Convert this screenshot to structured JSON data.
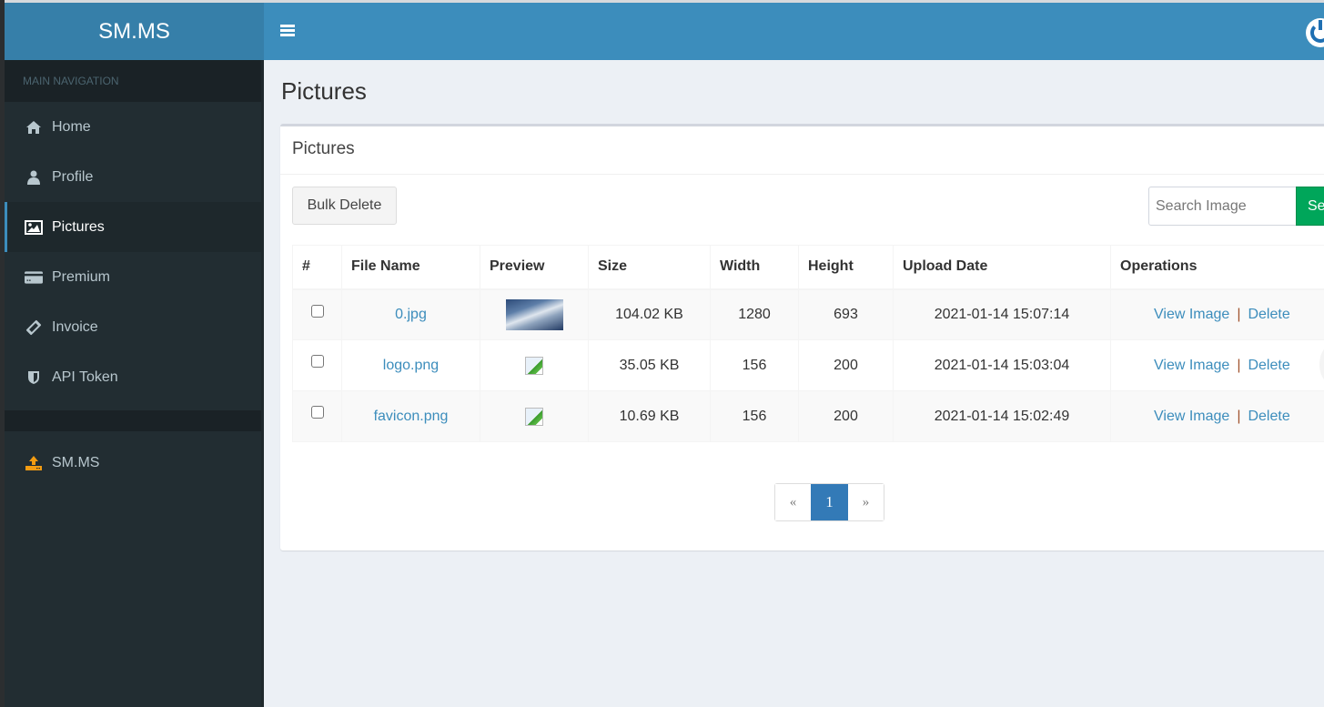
{
  "header": {
    "logo": "SM.MS",
    "menu_toggle_icon": "hamburger-icon",
    "power_icon": "power-icon"
  },
  "sidebar": {
    "section_header": "MAIN NAVIGATION",
    "items": [
      {
        "label": "Home",
        "icon": "home-icon",
        "active": false
      },
      {
        "label": "Profile",
        "icon": "user-icon",
        "active": false
      },
      {
        "label": "Pictures",
        "icon": "image-icon",
        "active": true
      },
      {
        "label": "Premium",
        "icon": "credit-card-icon",
        "active": false
      },
      {
        "label": "Invoice",
        "icon": "ticket-icon",
        "active": false
      },
      {
        "label": "API Token",
        "icon": "shield-icon",
        "active": false
      }
    ],
    "extra_items": [
      {
        "label": "SM.MS",
        "icon": "upload-icon",
        "color": "#f39c12"
      }
    ]
  },
  "page": {
    "title": "Pictures",
    "box_title": "Pictures",
    "bulk_delete_label": "Bulk Delete",
    "search_placeholder": "Search Image",
    "search_button_label": "Search"
  },
  "table": {
    "columns": [
      "#",
      "File Name",
      "Preview",
      "Size",
      "Width",
      "Height",
      "Upload Date",
      "Operations"
    ],
    "rows": [
      {
        "file_name": "0.jpg",
        "preview": "thumbnail",
        "size": "104.02 KB",
        "width": "1280",
        "height": "693",
        "upload_date": "2021-01-14 15:07:14",
        "view_label": "View Image",
        "delete_label": "Delete",
        "separator": "|"
      },
      {
        "file_name": "logo.png",
        "preview": "broken-image",
        "size": "35.05 KB",
        "width": "156",
        "height": "200",
        "upload_date": "2021-01-14 15:03:04",
        "view_label": "View Image",
        "delete_label": "Delete",
        "separator": "|"
      },
      {
        "file_name": "favicon.png",
        "preview": "broken-image",
        "size": "10.69 KB",
        "width": "156",
        "height": "200",
        "upload_date": "2021-01-14 15:02:49",
        "view_label": "View Image",
        "delete_label": "Delete",
        "separator": "|"
      }
    ]
  },
  "pagination": {
    "prev": "«",
    "current": "1",
    "next": "»"
  },
  "colors": {
    "navbar": "#3c8dbc",
    "logo_bg": "#367fa9",
    "sidebar_bg": "#222d32",
    "link": "#3c8dbc",
    "search_button": "#00a65a",
    "active_page": "#337ab7"
  }
}
